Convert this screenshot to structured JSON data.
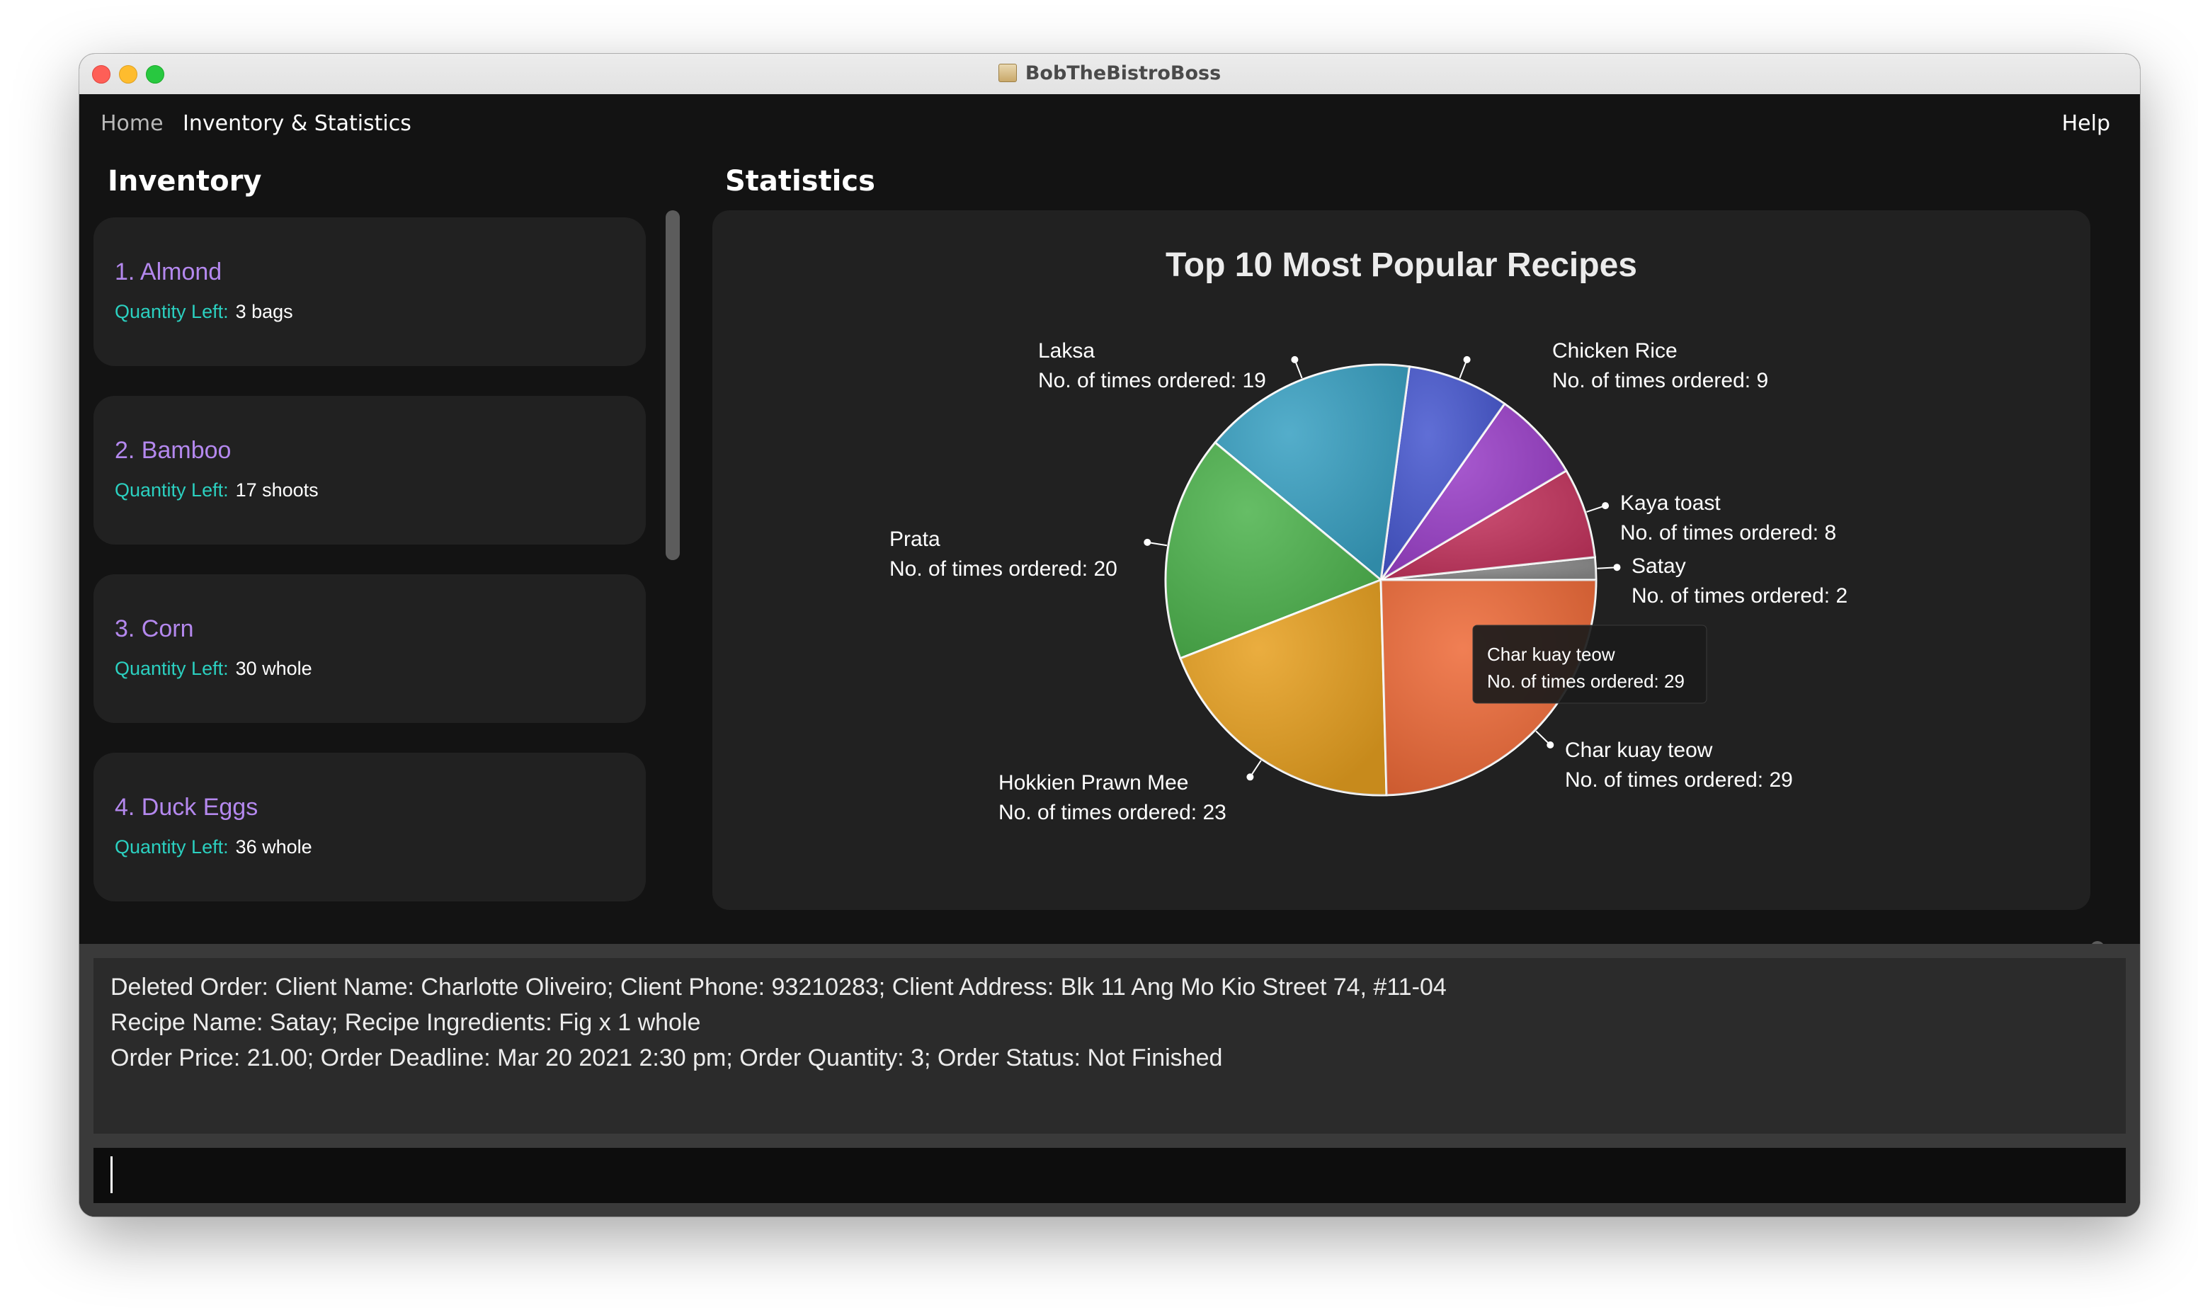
{
  "window": {
    "title": "BobTheBistroBoss"
  },
  "menu": {
    "home": "Home",
    "inventory_statistics": "Inventory & Statistics",
    "help": "Help"
  },
  "inventory": {
    "title": "Inventory",
    "quantity_label": "Quantity Left:",
    "items": [
      {
        "name": "1.  Almond",
        "quantity": "3 bags"
      },
      {
        "name": "2.  Bamboo",
        "quantity": "17 shoots"
      },
      {
        "name": "3.  Corn",
        "quantity": "30 whole"
      },
      {
        "name": "4.  Duck Eggs",
        "quantity": "36 whole"
      }
    ]
  },
  "statistics": {
    "title": "Statistics",
    "chart_data": {
      "type": "pie",
      "title": "Top 10 Most Popular Recipes",
      "slices": [
        {
          "name": "Satay",
          "label": "No. of times ordered: 2",
          "value": 2,
          "color": "#8b8b8b"
        },
        {
          "name": "Kaya toast",
          "label": "No. of times ordered: 8",
          "value": 8,
          "color": "#c4345e"
        },
        {
          "name": "",
          "label": "",
          "value": 8,
          "color": "#9a3fc8"
        },
        {
          "name": "Chicken Rice",
          "label": "No. of times ordered: 9",
          "value": 9,
          "color": "#4657cf"
        },
        {
          "name": "Laksa",
          "label": "No. of times ordered: 19",
          "value": 19,
          "color": "#38a0c2"
        },
        {
          "name": "Prata",
          "label": "No. of times ordered: 20",
          "value": 20,
          "color": "#4db34d"
        },
        {
          "name": "Hokkien Prawn Mee",
          "label": "No. of times ordered: 23",
          "value": 23,
          "color": "#e7a020"
        },
        {
          "name": "Char kuay teow",
          "label": "No. of times ordered: 29",
          "value": 29,
          "color": "#ee6a38"
        }
      ],
      "tooltip": {
        "name": "Char kuay teow",
        "label": "No. of times ordered: 29"
      }
    }
  },
  "result": {
    "lines": [
      "Deleted Order: Client Name: Charlotte Oliveiro; Client Phone: 93210283; Client Address: Blk 11 Ang Mo Kio Street 74, #11-04",
      "Recipe Name: Satay; Recipe Ingredients: Fig x 1 whole",
      "Order Price: 21.00; Order Deadline: Mar 20 2021 2:30 pm; Order Quantity: 3; Order Status: Not Finished"
    ]
  },
  "command": {
    "value": ""
  }
}
